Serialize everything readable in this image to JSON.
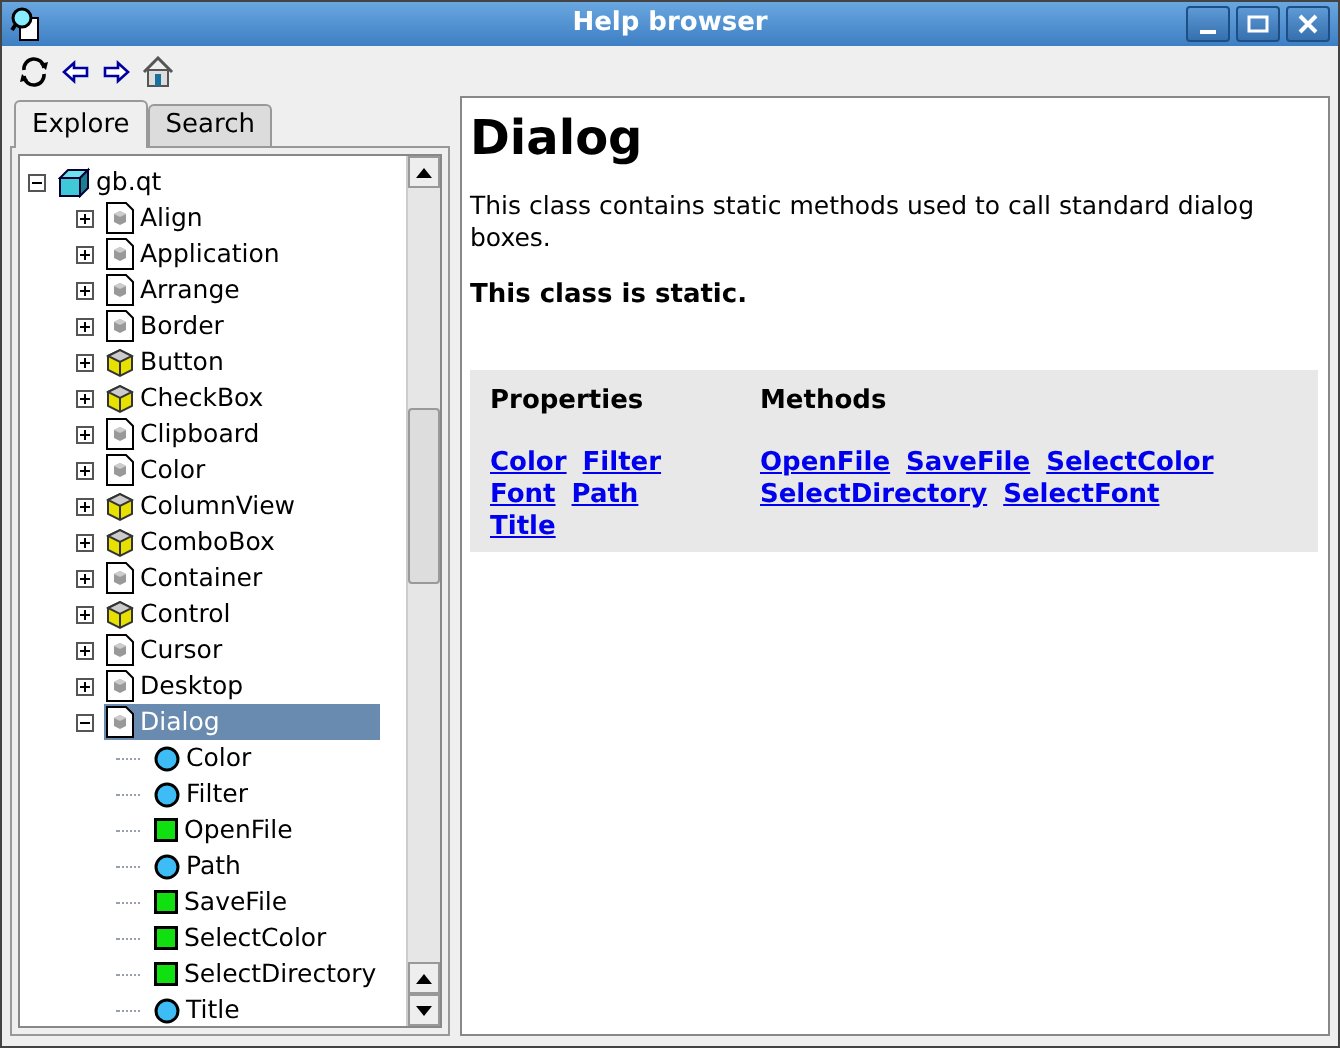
{
  "window": {
    "title": "Help browser"
  },
  "tabs": [
    {
      "label": "Explore",
      "selected": true
    },
    {
      "label": "Search",
      "selected": false
    }
  ],
  "tree": [
    {
      "label": "gb.qt",
      "kind": "module",
      "expanded": true,
      "selected": false,
      "children": [
        {
          "label": "Align",
          "kind": "class",
          "expanded": false,
          "selected": false
        },
        {
          "label": "Application",
          "kind": "class",
          "expanded": false,
          "selected": false
        },
        {
          "label": "Arrange",
          "kind": "class",
          "expanded": false,
          "selected": false
        },
        {
          "label": "Border",
          "kind": "class",
          "expanded": false,
          "selected": false
        },
        {
          "label": "Button",
          "kind": "control",
          "expanded": false,
          "selected": false
        },
        {
          "label": "CheckBox",
          "kind": "control",
          "expanded": false,
          "selected": false
        },
        {
          "label": "Clipboard",
          "kind": "class",
          "expanded": false,
          "selected": false
        },
        {
          "label": "Color",
          "kind": "class",
          "expanded": false,
          "selected": false
        },
        {
          "label": "ColumnView",
          "kind": "control",
          "expanded": false,
          "selected": false
        },
        {
          "label": "ComboBox",
          "kind": "control",
          "expanded": false,
          "selected": false
        },
        {
          "label": "Container",
          "kind": "class",
          "expanded": false,
          "selected": false
        },
        {
          "label": "Control",
          "kind": "control",
          "expanded": false,
          "selected": false
        },
        {
          "label": "Cursor",
          "kind": "class",
          "expanded": false,
          "selected": false
        },
        {
          "label": "Desktop",
          "kind": "class",
          "expanded": false,
          "selected": false
        },
        {
          "label": "Dialog",
          "kind": "class",
          "expanded": true,
          "selected": true,
          "children": [
            {
              "label": "Color",
              "kind": "property",
              "selected": false
            },
            {
              "label": "Filter",
              "kind": "property",
              "selected": false
            },
            {
              "label": "OpenFile",
              "kind": "method",
              "selected": false
            },
            {
              "label": "Path",
              "kind": "property",
              "selected": false
            },
            {
              "label": "SaveFile",
              "kind": "method",
              "selected": false
            },
            {
              "label": "SelectColor",
              "kind": "method",
              "selected": false
            },
            {
              "label": "SelectDirectory",
              "kind": "method",
              "selected": false
            },
            {
              "label": "Title",
              "kind": "property",
              "selected": false
            }
          ]
        }
      ]
    }
  ],
  "page": {
    "title": "Dialog",
    "description": "This class contains static methods used to call standard dialog boxes.",
    "note": "This class is static.",
    "properties": {
      "heading": "Properties",
      "links": [
        "Color",
        "Filter",
        "Font",
        "Path",
        "Title"
      ]
    },
    "methods": {
      "heading": "Methods",
      "links": [
        "OpenFile",
        "SaveFile",
        "SelectColor",
        "SelectDirectory",
        "SelectFont"
      ]
    }
  }
}
